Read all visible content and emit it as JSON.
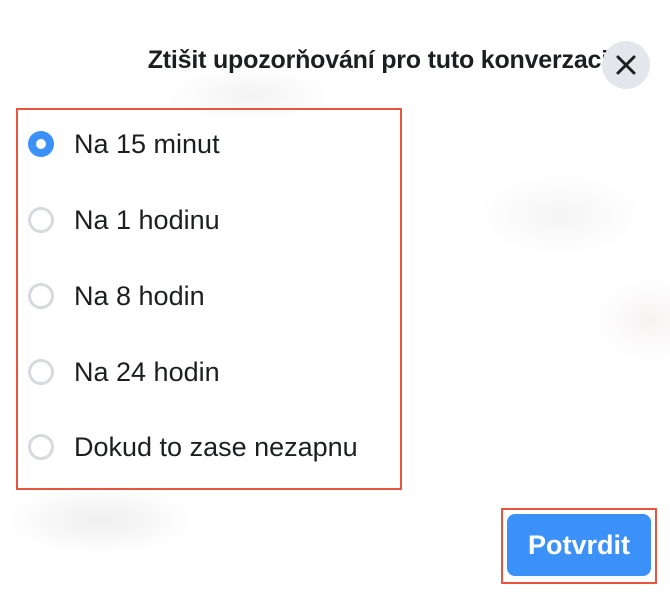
{
  "dialog": {
    "title": "Ztišit upozorňování pro tuto konverzaci",
    "close_icon": "close-icon"
  },
  "options": [
    {
      "label": "Na 15 minut",
      "selected": true
    },
    {
      "label": "Na 1 hodinu",
      "selected": false
    },
    {
      "label": "Na 8 hodin",
      "selected": false
    },
    {
      "label": "Na 24 hodin",
      "selected": false
    },
    {
      "label": "Dokud to zase nezapnu",
      "selected": false
    }
  ],
  "actions": {
    "confirm_label": "Potvrdit"
  },
  "colors": {
    "accent": "#3b91f7",
    "highlight_border": "#e8553f",
    "close_button_bg": "#e4e6eb"
  }
}
